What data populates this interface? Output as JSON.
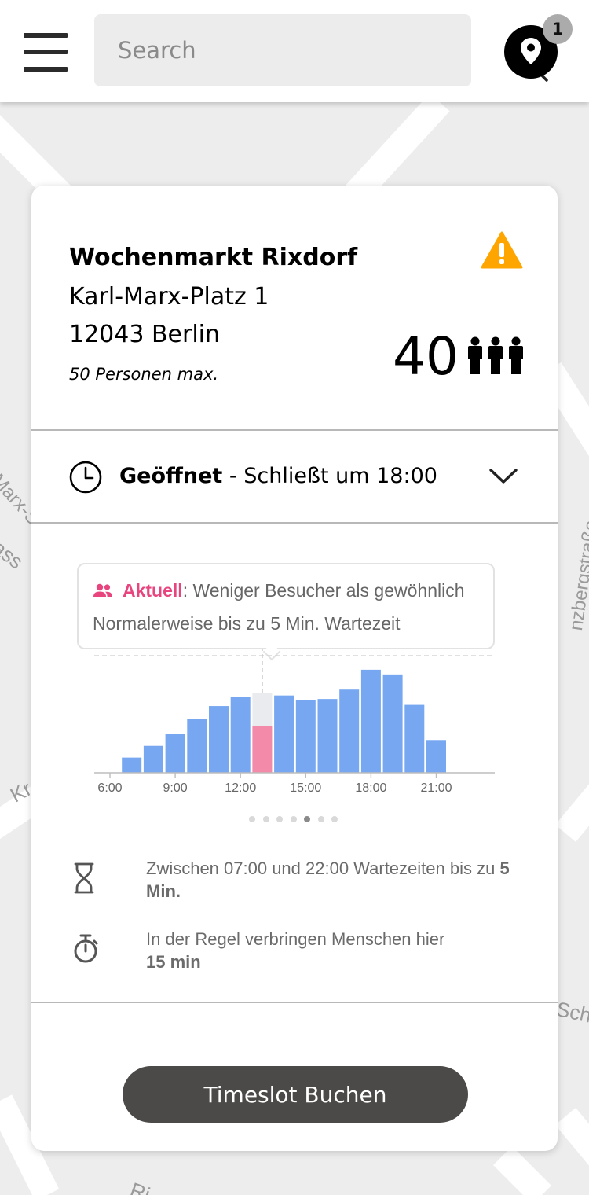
{
  "header": {
    "search_placeholder": "Search",
    "location_badge": "1"
  },
  "map": {
    "street_labels": [
      "Karl-Marx-Straße",
      "gass",
      "Kr",
      "Schl",
      "Ri",
      "nzbergstraße"
    ]
  },
  "venue": {
    "name": "Wochenmarkt Rixdorf",
    "street": "Karl-Marx-Platz 1",
    "city": "12043 Berlin",
    "max_capacity": "50 Personen max.",
    "current_visitors": "40",
    "warning_color": "#FFA500"
  },
  "hours": {
    "status": "Geöffnet",
    "closing": " - Schließt um 18:00"
  },
  "popular_times": {
    "tooltip_label": "Aktuell",
    "tooltip_text": ": Weniger Besucher als gewöhnlich",
    "tooltip_subtext": "Normalerweise bis zu 5 Min. Wartezeit",
    "page_count": 7,
    "active_page": 5
  },
  "chart_data": {
    "type": "bar",
    "tick_labels": [
      "6:00",
      "9:00",
      "12:00",
      "15:00",
      "18:00",
      "21:00"
    ],
    "tick_hours": [
      6,
      9,
      12,
      15,
      18,
      21
    ],
    "x": [
      7,
      8,
      9,
      10,
      11,
      12,
      13,
      14,
      15,
      16,
      17,
      18,
      19,
      20,
      21
    ],
    "usual_values": [
      13,
      23,
      33,
      46,
      57,
      65,
      68,
      66,
      62,
      63,
      71,
      88,
      84,
      58,
      28
    ],
    "current_hour": 13,
    "current_value": 40,
    "ylim": [
      0,
      100
    ],
    "colors": {
      "usual": "#77a7f1",
      "current": "#f48aa9",
      "current_usual": "#e9ebee"
    }
  },
  "info": {
    "wait_text": "Zwischen 07:00 und 22:00 Wartezeiten bis zu ",
    "wait_value": "5 Min.",
    "stay_text": "In der Regel verbringen Menschen hier ",
    "stay_value": "15 min"
  },
  "book_button": "Timeslot Buchen"
}
